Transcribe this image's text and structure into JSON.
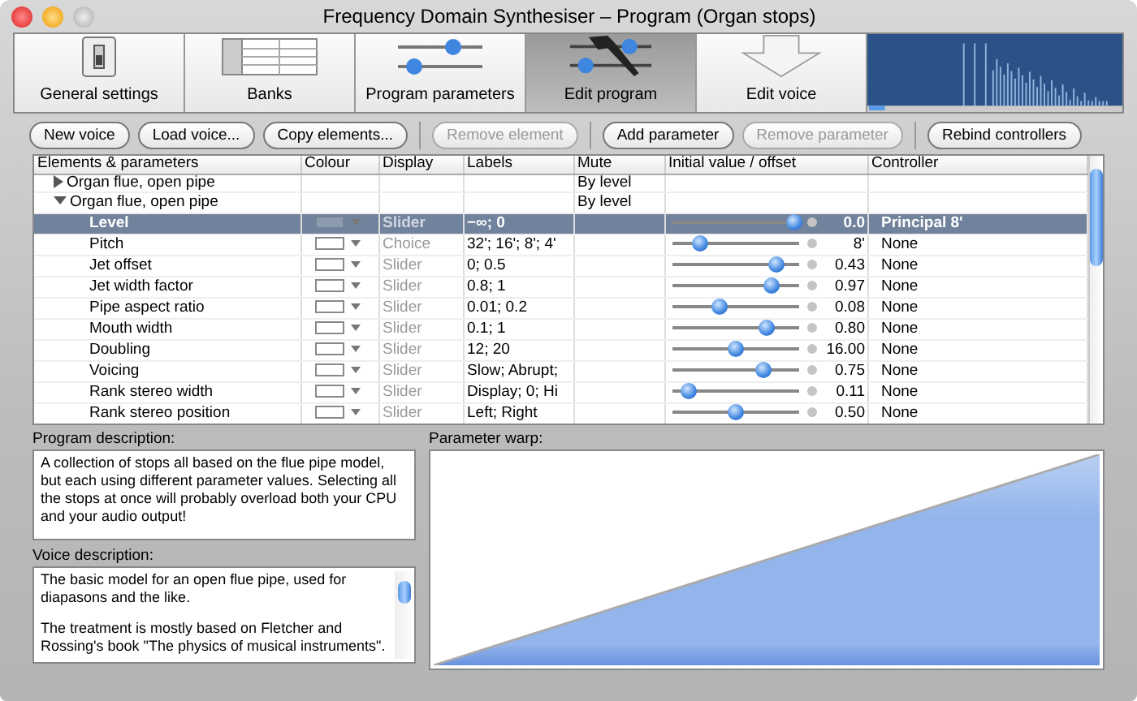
{
  "window": {
    "title": "Frequency Domain Synthesiser – Program (Organ stops)"
  },
  "tabs": [
    {
      "label": "General settings",
      "kind": "switch",
      "selected": false
    },
    {
      "label": "Banks",
      "kind": "banks",
      "selected": false
    },
    {
      "label": "Program parameters",
      "kind": "sliders",
      "selected": false
    },
    {
      "label": "Edit program",
      "kind": "tools",
      "selected": true
    },
    {
      "label": "Edit voice",
      "kind": "arrow",
      "selected": false
    }
  ],
  "button_groups": [
    [
      {
        "label": "New voice",
        "disabled": false
      },
      {
        "label": "Load voice...",
        "disabled": false
      },
      {
        "label": "Copy elements...",
        "disabled": false
      }
    ],
    [
      {
        "label": "Remove element",
        "disabled": true
      }
    ],
    [
      {
        "label": "Add parameter",
        "disabled": false
      },
      {
        "label": "Remove parameter",
        "disabled": true
      }
    ],
    [
      {
        "label": "Rebind controllers",
        "disabled": false
      }
    ]
  ],
  "table": {
    "columns": [
      "Elements & parameters",
      "Colour",
      "Display",
      "Labels",
      "Mute",
      "Initial value / offset",
      "Controller"
    ],
    "rows": [
      {
        "kind": "group",
        "label": "Organ flue, open pipe",
        "expanded": false,
        "mute": "By level",
        "selected": false
      },
      {
        "kind": "group",
        "label": "Organ flue, open pipe",
        "expanded": true,
        "mute": "By level",
        "selected": false
      },
      {
        "kind": "param",
        "label": "Level",
        "display": "Slider",
        "labels": "−∞; 0",
        "level": 0.97,
        "value": "0.0",
        "controller": "Principal 8'",
        "selected": true
      },
      {
        "kind": "param",
        "label": "Pitch",
        "display": "Choice",
        "labels": "32'; 16'; 8'; 4'",
        "level": 0.22,
        "value": "8'",
        "controller": "None",
        "selected": false
      },
      {
        "kind": "param",
        "label": "Jet offset",
        "display": "Slider",
        "labels": "0; 0.5",
        "level": 0.83,
        "value": "0.43",
        "controller": "None",
        "selected": false
      },
      {
        "kind": "param",
        "label": "Jet width factor",
        "display": "Slider",
        "labels": "0.8; 1",
        "level": 0.79,
        "value": "0.97",
        "controller": "None",
        "selected": false
      },
      {
        "kind": "param",
        "label": "Pipe aspect ratio",
        "display": "Slider",
        "labels": "0.01; 0.2",
        "level": 0.38,
        "value": "0.08",
        "controller": "None",
        "selected": false
      },
      {
        "kind": "param",
        "label": "Mouth width",
        "display": "Slider",
        "labels": "0.1; 1",
        "level": 0.75,
        "value": "0.80",
        "controller": "None",
        "selected": false
      },
      {
        "kind": "param",
        "label": "Doubling",
        "display": "Slider",
        "labels": "12; 20",
        "level": 0.5,
        "value": "16.00",
        "controller": "None",
        "selected": false
      },
      {
        "kind": "param",
        "label": "Voicing",
        "display": "Slider",
        "labels": "Slow; Abrupt;",
        "level": 0.73,
        "value": "0.75",
        "controller": "None",
        "selected": false
      },
      {
        "kind": "param",
        "label": "Rank stereo width",
        "display": "Slider",
        "labels": "Display; 0; Hi",
        "level": 0.13,
        "value": "0.11",
        "controller": "None",
        "selected": false
      },
      {
        "kind": "param",
        "label": "Rank stereo position",
        "display": "Slider",
        "labels": "Left; Right",
        "level": 0.5,
        "value": "0.50",
        "controller": "None",
        "selected": false
      }
    ]
  },
  "program_description": {
    "label": "Program description:",
    "text": "A collection of stops all based on the flue pipe model, but each using different parameter values.  Selecting all the stops at once will probably overload both your CPU and your audio output!"
  },
  "voice_description": {
    "label": "Voice description:",
    "paragraphs": [
      "The basic model for an open flue pipe, used for diapasons and the like.",
      "The treatment is mostly based on Fletcher and Rossing's book \"The physics of musical instruments\"."
    ]
  },
  "parameter_warp": {
    "label": "Parameter warp:"
  }
}
